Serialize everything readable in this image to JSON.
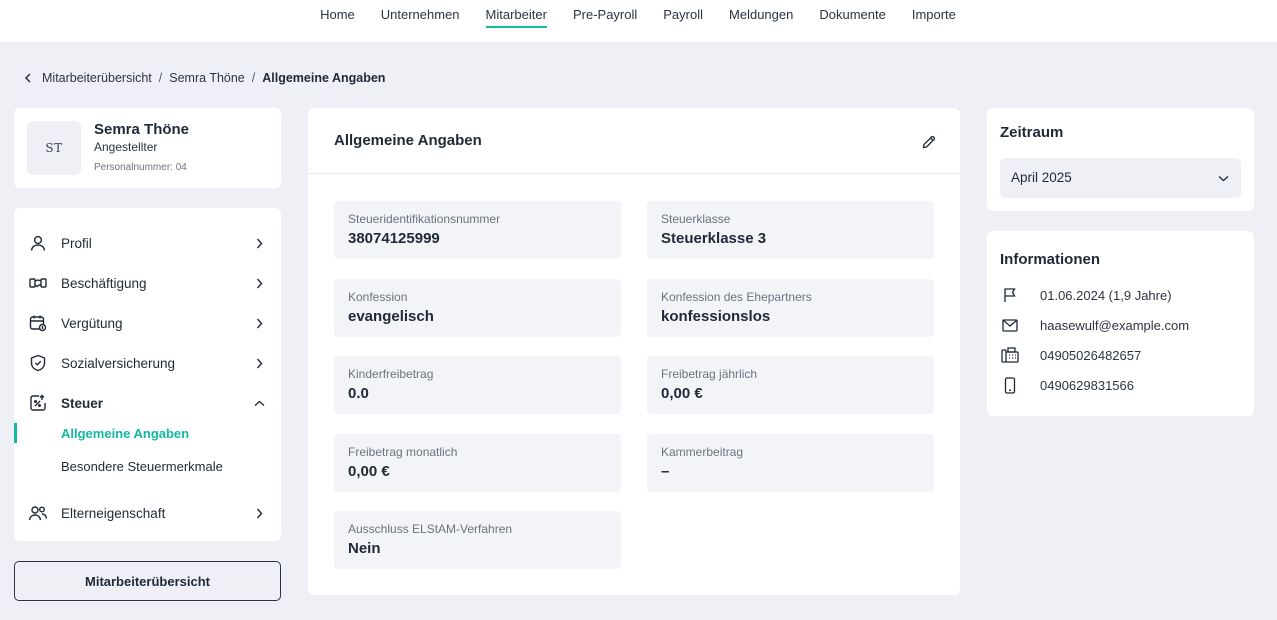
{
  "nav": {
    "items": [
      {
        "label": "Home",
        "active": false
      },
      {
        "label": "Unternehmen",
        "active": false
      },
      {
        "label": "Mitarbeiter",
        "active": true
      },
      {
        "label": "Pre-Payroll",
        "active": false
      },
      {
        "label": "Payroll",
        "active": false
      },
      {
        "label": "Meldungen",
        "active": false
      },
      {
        "label": "Dokumente",
        "active": false
      },
      {
        "label": "Importe",
        "active": false
      }
    ]
  },
  "breadcrumb": {
    "items": [
      "Mitarbeiterübersicht",
      "Semra Thöne"
    ],
    "current": "Allgemeine Angaben"
  },
  "profile": {
    "initials": "ST",
    "name": "Semra Thöne",
    "role": "Angestellter",
    "personnel_number": "Personalnummer: 04"
  },
  "menu": {
    "items": [
      {
        "label": "Profil",
        "icon": "user-icon"
      },
      {
        "label": "Beschäftigung",
        "icon": "employment-icon"
      },
      {
        "label": "Vergütung",
        "icon": "calendar-money-icon"
      },
      {
        "label": "Sozialversicherung",
        "icon": "shield-icon"
      },
      {
        "label": "Steuer",
        "icon": "tax-icon",
        "expanded": true
      },
      {
        "label": "Elterneigenschaft",
        "icon": "users-icon"
      }
    ],
    "tax_subitems": [
      {
        "label": "Allgemeine Angaben",
        "active": true
      },
      {
        "label": "Besondere Steuermerkmale",
        "active": false
      }
    ],
    "overview_button": "Mitarbeiterübersicht"
  },
  "main": {
    "title": "Allgemeine Angaben",
    "fields": [
      {
        "label": "Steueridentifikationsnummer",
        "value": "38074125999"
      },
      {
        "label": "Steuerklasse",
        "value": "Steuerklasse 3"
      },
      {
        "label": "Konfession",
        "value": "evangelisch"
      },
      {
        "label": "Konfession des Ehepartners",
        "value": "konfessionslos"
      },
      {
        "label": "Kinderfreibetrag",
        "value": "0.0"
      },
      {
        "label": "Freibetrag jährlich",
        "value": "0,00 €"
      },
      {
        "label": "Freibetrag monatlich",
        "value": "0,00 €"
      },
      {
        "label": "Kammerbeitrag",
        "value": "–"
      },
      {
        "label": "Ausschluss ELStAM-Verfahren",
        "value": "Nein"
      }
    ]
  },
  "period": {
    "title": "Zeitraum",
    "selected": "April 2025"
  },
  "info": {
    "title": "Informationen",
    "rows": [
      {
        "icon": "flag-icon",
        "text": "01.06.2024 (1,9 Jahre)"
      },
      {
        "icon": "mail-icon",
        "text": "haasewulf@example.com"
      },
      {
        "icon": "phone-icon",
        "text": "04905026482657"
      },
      {
        "icon": "mobile-icon",
        "text": "0490629831566"
      }
    ]
  },
  "colors": {
    "accent": "#12b8a0",
    "background": "#eef0f6",
    "field_background": "#f2f4f7",
    "text": "#1f2937",
    "muted": "#6b7280"
  }
}
